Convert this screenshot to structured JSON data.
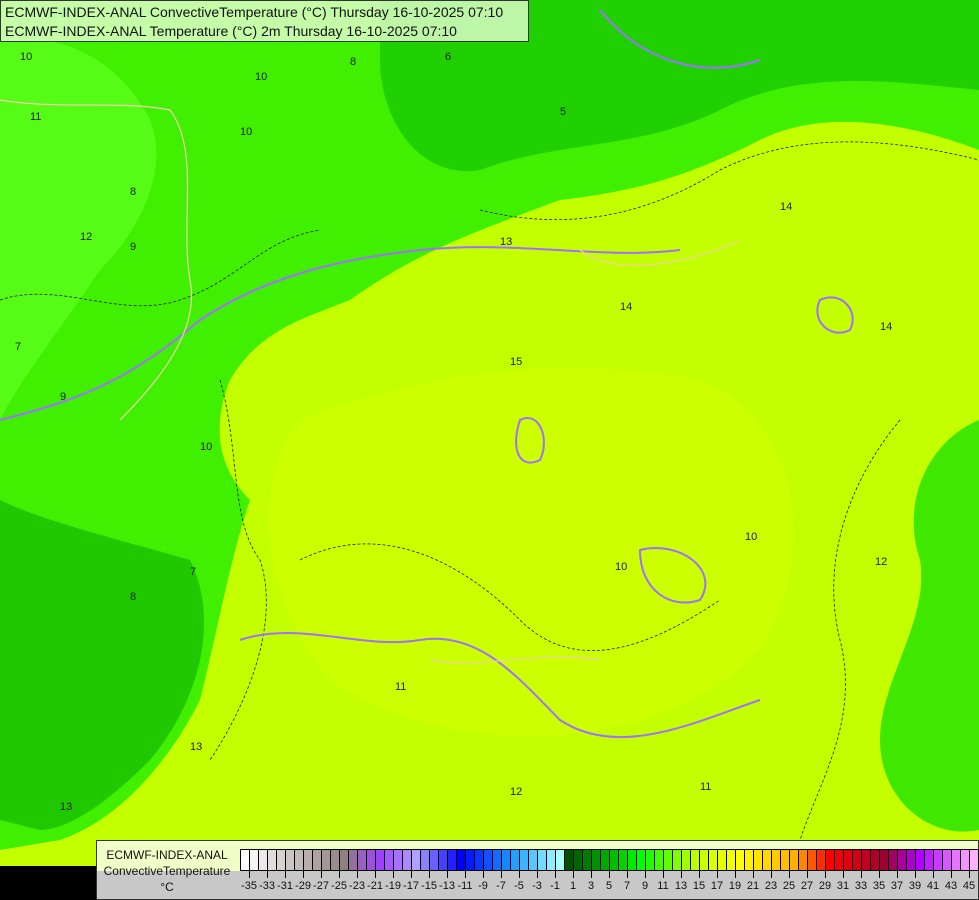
{
  "title": {
    "line1": "ECMWF-INDEX-ANAL ConvectiveTemperature (°C) Thursday 16-10-2025 07:10",
    "line2": "ECMWF-INDEX-ANAL Temperature (°C) 2m Thursday 16-10-2025 07:10"
  },
  "legend": {
    "model": "ECMWF-INDEX-ANAL",
    "parameter": "ConvectiveTemperature",
    "unit": "°C",
    "min": -36,
    "max": 45,
    "tick_labels": [
      "-35",
      "-33",
      "-31",
      "-29",
      "-27",
      "-25",
      "-23",
      "-21",
      "-19",
      "-17",
      "-15",
      "-13",
      "-11",
      "-9",
      "-7",
      "-5",
      "-3",
      "-1",
      "1",
      "3",
      "5",
      "7",
      "9",
      "11",
      "13",
      "15",
      "17",
      "19",
      "21",
      "23",
      "25",
      "27",
      "29",
      "31",
      "33",
      "35",
      "37",
      "39",
      "41",
      "43",
      "45"
    ],
    "color_stops": [
      {
        "value": -36,
        "color": "#ffffff"
      },
      {
        "value": -25,
        "color": "#908080"
      },
      {
        "value": -21,
        "color": "#a040ff"
      },
      {
        "value": -17,
        "color": "#b0a0ff"
      },
      {
        "value": -12,
        "color": "#0000ff"
      },
      {
        "value": -6,
        "color": "#20a0ff"
      },
      {
        "value": -1,
        "color": "#a8ffff"
      },
      {
        "value": 0,
        "color": "#005000"
      },
      {
        "value": 8,
        "color": "#00ff00"
      },
      {
        "value": 14,
        "color": "#c0ff00"
      },
      {
        "value": 19,
        "color": "#ffff00"
      },
      {
        "value": 25,
        "color": "#ffb000"
      },
      {
        "value": 29,
        "color": "#ff0000"
      },
      {
        "value": 35,
        "color": "#a00030"
      },
      {
        "value": 39,
        "color": "#b000ff"
      },
      {
        "value": 45,
        "color": "#ffb0ff"
      }
    ]
  },
  "contour_labels": [
    "10",
    "10",
    "10",
    "8",
    "8",
    "6",
    "5",
    "12",
    "11",
    "9",
    "9",
    "8",
    "7",
    "7",
    "14",
    "13",
    "13",
    "15",
    "14",
    "14",
    "13",
    "10",
    "10",
    "11",
    "12",
    "12",
    "11",
    "10"
  ]
}
